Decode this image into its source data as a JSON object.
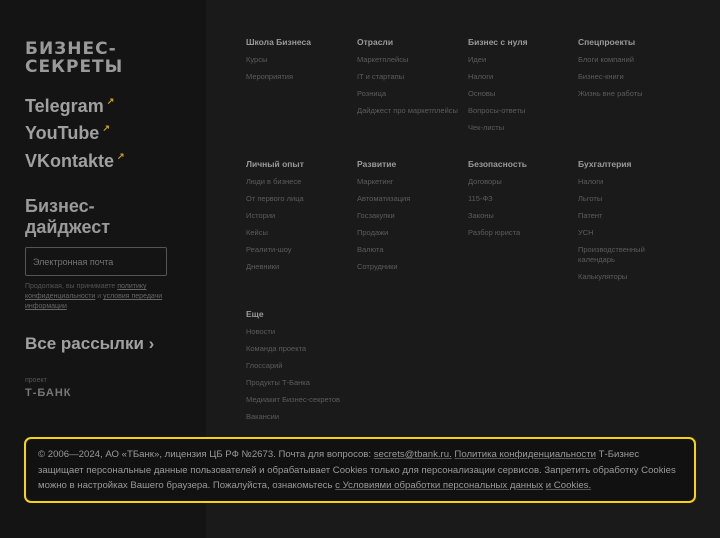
{
  "brand": {
    "logo": "БИЗНЕС-\nСЕКРЕТЫ",
    "project_label": "проект",
    "bank": "Т-БАНК"
  },
  "social": [
    {
      "label": "Telegram",
      "icon": "external-link-icon"
    },
    {
      "label": "YouTube",
      "icon": "external-link-icon"
    },
    {
      "label": "VKontakte",
      "icon": "external-link-icon"
    }
  ],
  "digest": {
    "title": "Бизнес-\nдайджест",
    "placeholder": "Электронная почта",
    "terms_prefix": "Продолжая, вы принимаете ",
    "terms_link1": "политику конфиденциальности",
    "terms_mid": " и ",
    "terms_link2": "условия передачи информации",
    "all_label": "Все рассылки"
  },
  "columns": [
    {
      "title": "Школа Бизнеса",
      "items": [
        "Курсы",
        "Мероприятия"
      ]
    },
    {
      "title": "Отрасли",
      "items": [
        "Маркетплейсы",
        "IT и стартапы",
        "Розница",
        "Дайджест про маркетплейсы"
      ]
    },
    {
      "title": "Бизнес с нуля",
      "items": [
        "Идеи",
        "Налоги",
        "Основы",
        "Вопросы-ответы",
        "Чек-листы"
      ]
    },
    {
      "title": "Спецпроекты",
      "items": [
        "Блоги компаний",
        "Бизнес-книги",
        "Жизнь вне работы"
      ]
    },
    {
      "title": "Личный опыт",
      "items": [
        "Люди в бизнесе",
        "От первого лица",
        "Истории",
        "Кейсы",
        "Реалити-шоу",
        "Дневники"
      ]
    },
    {
      "title": "Развитие",
      "items": [
        "Маркетинг",
        "Автоматизация",
        "Госзакупки",
        "Продажи",
        "Валюта",
        "Сотрудники"
      ]
    },
    {
      "title": "Безопасность",
      "items": [
        "Договоры",
        "115-ФЗ",
        "Законы",
        "Разбор юриста"
      ]
    },
    {
      "title": "Бухгалтерия",
      "items": [
        "Налоги",
        "Льготы",
        "Патент",
        "УСН",
        "Производственный календарь",
        "Калькуляторы"
      ]
    },
    {
      "title": "Еще",
      "items": [
        "Новости",
        "Команда проекта",
        "Глоссарий",
        "Продукты Т-Банка",
        "Медиакит Бизнес-секретов",
        "Вакансии"
      ]
    }
  ],
  "cookie": {
    "t1": "© 2006—2024, АО «ТБанк», лицензия ЦБ РФ №2673. Почта для вопросов: ",
    "email": "secrets@tbank.ru.",
    "privacy": "Политика конфиденциальности",
    "t2": " Т-Бизнес защищает персональные данные пользователей и обрабатывает Cookies только для персонализации сервисов. Запретить обработку Cookies можно в настройках Вашего браузера. Пожалуйста, ознакомьтесь ",
    "terms": "с Условиями обработки персональных данных",
    "and": " ",
    "cookies": "и Cookies.",
    "border_color": "#f5d40f"
  }
}
